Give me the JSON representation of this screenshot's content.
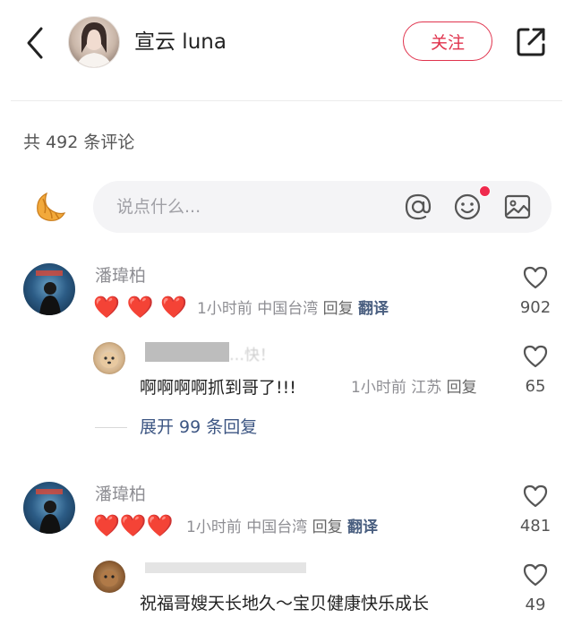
{
  "header": {
    "title": "宣云 luna",
    "follow_label": "关注"
  },
  "comments_count": "共 492 条评论",
  "input": {
    "placeholder": "说点什么..."
  },
  "comments": [
    {
      "name": "潘瑋柏",
      "hearts": "❤️ ❤️ ❤️",
      "time": "1小时前",
      "location": "中国台湾",
      "reply_label": "回复",
      "translate_label": "翻译",
      "likes": "902",
      "sub_reply": {
        "name_partial": "…快！",
        "text": "啊啊啊啊抓到哥了!!!",
        "time": "1小时前",
        "location": "江苏",
        "reply_label": "回复",
        "likes": "65"
      },
      "expand_label": "展开 99 条回复"
    },
    {
      "name": "潘瑋柏",
      "hearts": "❤️❤️❤️",
      "time": "1小时前",
      "location": "中国台湾",
      "reply_label": "回复",
      "translate_label": "翻译",
      "likes": "481",
      "sub_reply": {
        "text": "祝福哥嫂天长地久～宝贝健康快乐成长",
        "likes": "49"
      }
    }
  ],
  "colors": {
    "accent": "#e0334d",
    "link": "#3d5683"
  }
}
